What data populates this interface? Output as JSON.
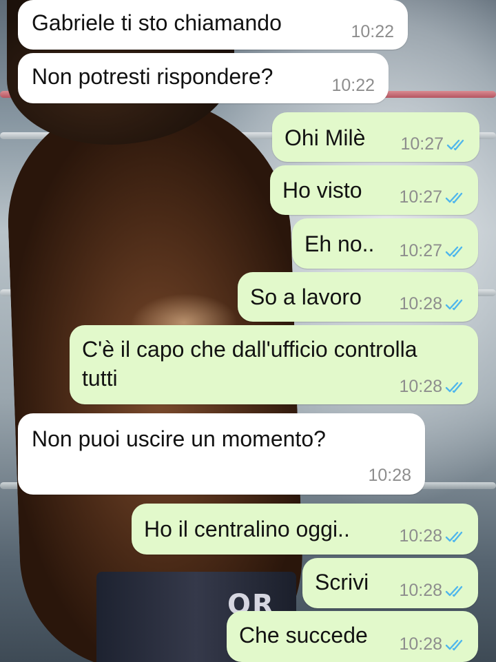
{
  "messages": [
    {
      "direction": "in",
      "text": "Gabriele ti sto chiamando",
      "time": "10:22"
    },
    {
      "direction": "in",
      "text": "Non potresti rispondere?",
      "time": "10:22"
    },
    {
      "direction": "out",
      "text": "Ohi Milè",
      "time": "10:27",
      "status": "read",
      "status_icon": "double-check-icon"
    },
    {
      "direction": "out",
      "text": "Ho visto",
      "time": "10:27",
      "status": "read",
      "status_icon": "double-check-icon"
    },
    {
      "direction": "out",
      "text": "Eh no..",
      "time": "10:27",
      "status": "read",
      "status_icon": "double-check-icon"
    },
    {
      "direction": "out",
      "text": "So a lavoro",
      "time": "10:28",
      "status": "read",
      "status_icon": "double-check-icon"
    },
    {
      "direction": "out",
      "text_line1": "C'è il capo che dall'ufficio controlla",
      "text_line2": "tutti",
      "time": "10:28",
      "status": "read",
      "status_icon": "double-check-icon"
    },
    {
      "direction": "in",
      "text": "Non puoi uscire un momento?",
      "time": "10:28"
    },
    {
      "direction": "out",
      "text": "Ho il centralino oggi..",
      "time": "10:28",
      "status": "read",
      "status_icon": "double-check-icon"
    },
    {
      "direction": "out",
      "text": "Scrivi",
      "time": "10:28",
      "status": "read",
      "status_icon": "double-check-icon"
    },
    {
      "direction": "out",
      "text": "Che succede",
      "time": "10:28",
      "status": "read",
      "status_icon": "double-check-icon"
    }
  ],
  "colors": {
    "incoming_bubble": "#ffffff",
    "outgoing_bubble": "#e2f9cb",
    "read_tick": "#4fb6ec",
    "timestamp": "#8d8d8d"
  },
  "wallpaper": {
    "shorts_lettering": "ORI"
  }
}
